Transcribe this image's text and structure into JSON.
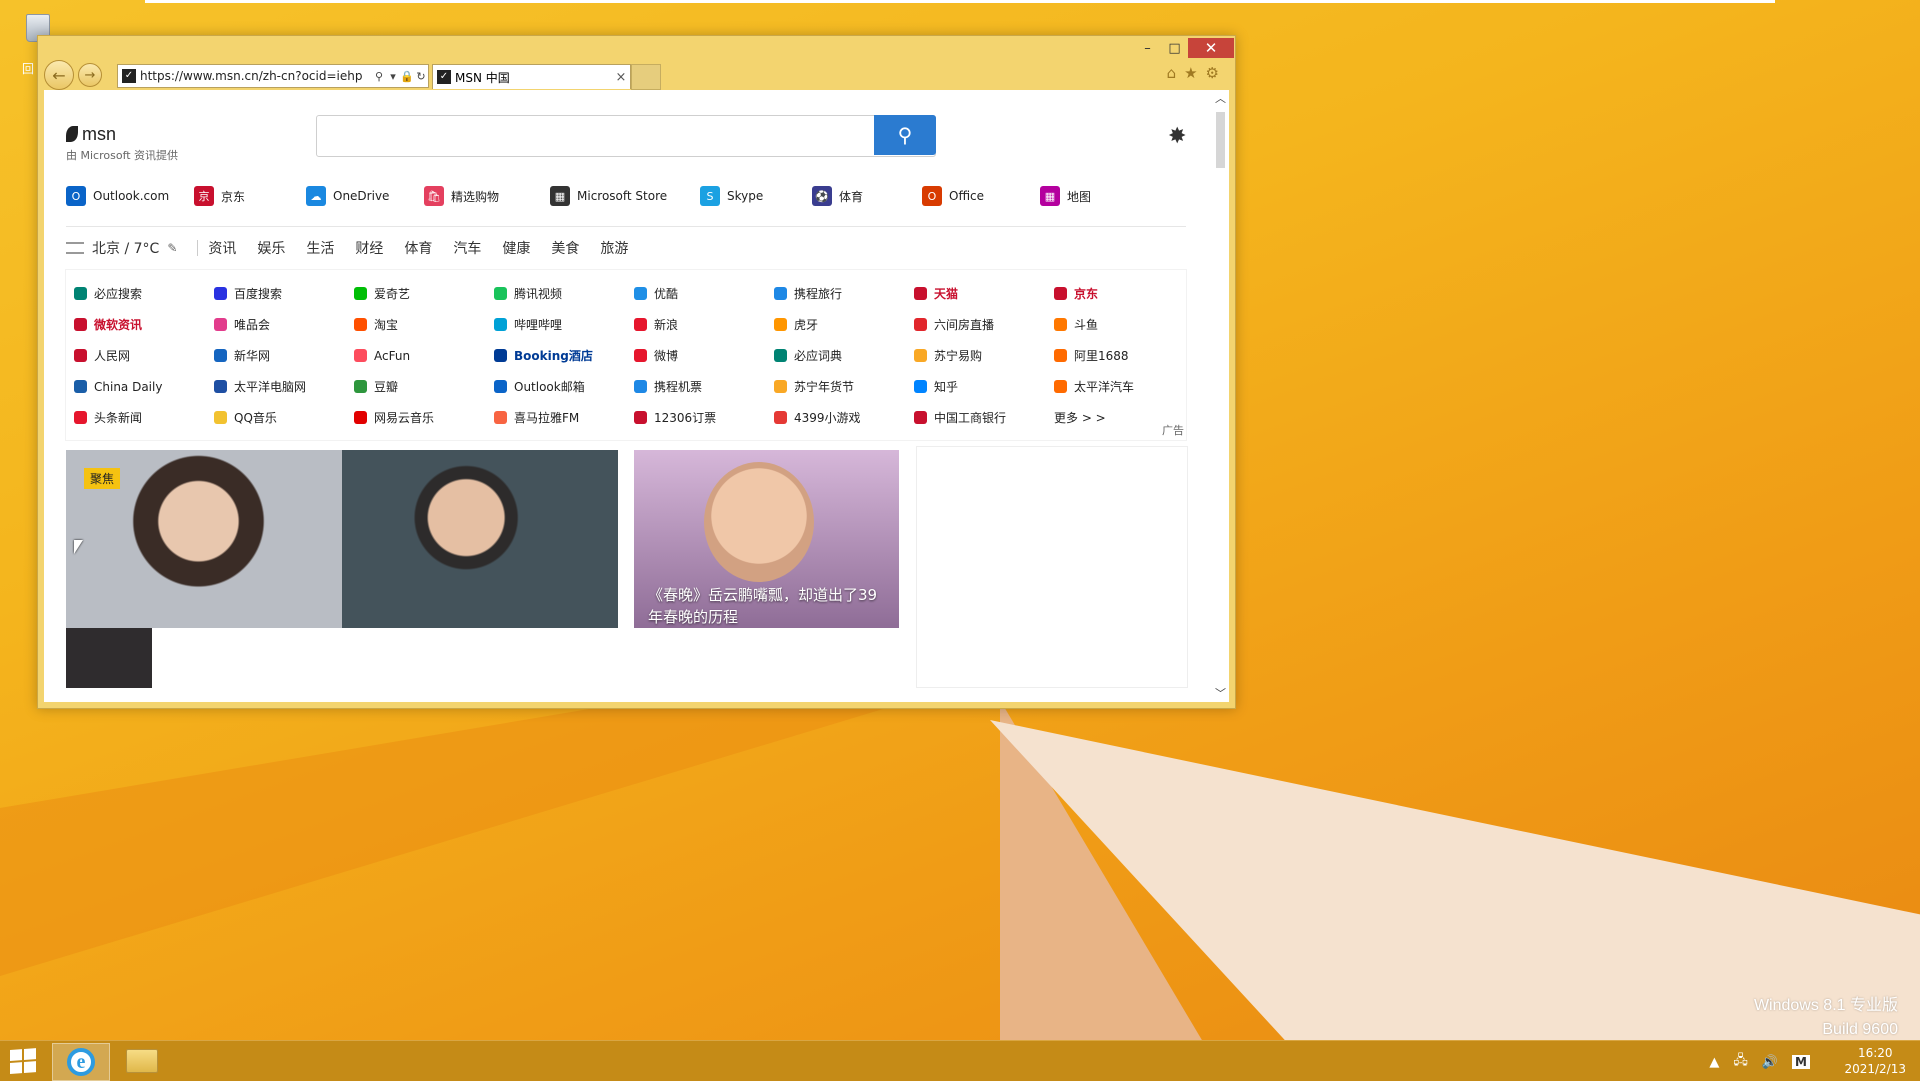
{
  "desktop": {
    "recycle_label": "回",
    "watermark_line1": "Windows 8.1 专业版",
    "watermark_line2": "Build 9600"
  },
  "window": {
    "controls": {
      "minimize": "–",
      "maximize": "□",
      "close": "✕"
    },
    "back_label": "←",
    "forward_label": "→",
    "address_url": "https://www.msn.cn/zh-cn?ocid=iehp",
    "address_icons": [
      "⚲",
      "▾",
      "🔒",
      "↻"
    ],
    "tab_title": "MSN 中国",
    "tab_close": "×",
    "tools": [
      "⌂",
      "★",
      "⚙"
    ]
  },
  "msn": {
    "logo_text": "msn",
    "logo_sub": "由 Microsoft 资讯提供",
    "search_icon": "⚲",
    "settings_icon": "✸",
    "quick_links": [
      {
        "label": "Outlook.com",
        "color": "#0a64c8",
        "glyph": "O"
      },
      {
        "label": "京东",
        "color": "#c8102e",
        "glyph": "京"
      },
      {
        "label": "OneDrive",
        "color": "#1a88e0",
        "glyph": "☁"
      },
      {
        "label": "精选购物",
        "color": "#e4405f",
        "glyph": "🛍"
      },
      {
        "label": "Microsoft Store",
        "color": "#333333",
        "glyph": "▦"
      },
      {
        "label": "Skype",
        "color": "#1ba1e2",
        "glyph": "S"
      },
      {
        "label": "体育",
        "color": "#3a3d8f",
        "glyph": "⚽"
      },
      {
        "label": "Office",
        "color": "#d83b01",
        "glyph": "O"
      },
      {
        "label": "地图",
        "color": "#b4009e",
        "glyph": "▦"
      }
    ],
    "weather": "北京 / 7°C",
    "categories": [
      "资讯",
      "娱乐",
      "生活",
      "财经",
      "体育",
      "汽车",
      "健康",
      "美食",
      "旅游"
    ],
    "links": [
      {
        "label": "必应搜索",
        "color": "#008373"
      },
      {
        "label": "百度搜索",
        "color": "#2932e1"
      },
      {
        "label": "爱奇艺",
        "color": "#00be06"
      },
      {
        "label": "腾讯视频",
        "color": "#19c35b"
      },
      {
        "label": "优酷",
        "color": "#1f8fe6"
      },
      {
        "label": "携程旅行",
        "color": "#1e88e5"
      },
      {
        "label": "天猫",
        "color": "#c8102e",
        "style": "red"
      },
      {
        "label": "京东",
        "color": "#c8102e",
        "style": "red"
      },
      {
        "label": "微软资讯",
        "color": "#c8102e",
        "style": "red"
      },
      {
        "label": "唯品会",
        "color": "#e23c8c"
      },
      {
        "label": "淘宝",
        "color": "#ff5000"
      },
      {
        "label": "哔哩哔哩",
        "color": "#00a1d6"
      },
      {
        "label": "新浪",
        "color": "#e6162d"
      },
      {
        "label": "虎牙",
        "color": "#ff9600"
      },
      {
        "label": "六间房直播",
        "color": "#e1262c"
      },
      {
        "label": "斗鱼",
        "color": "#ff7800"
      },
      {
        "label": "人民网",
        "color": "#c8102e"
      },
      {
        "label": "新华网",
        "color": "#1565c0"
      },
      {
        "label": "AcFun",
        "color": "#fd4c5d"
      },
      {
        "label": "Booking酒店",
        "color": "#003b95",
        "style": "blue"
      },
      {
        "label": "微博",
        "color": "#e6162d"
      },
      {
        "label": "必应词典",
        "color": "#008373"
      },
      {
        "label": "苏宁易购",
        "color": "#f9a825"
      },
      {
        "label": "阿里1688",
        "color": "#ff6a00"
      },
      {
        "label": "China Daily",
        "color": "#1a5ea8"
      },
      {
        "label": "太平洋电脑网",
        "color": "#1e4fa3"
      },
      {
        "label": "豆瓣",
        "color": "#2e963d"
      },
      {
        "label": "Outlook邮箱",
        "color": "#0a64c8"
      },
      {
        "label": "携程机票",
        "color": "#1e88e5"
      },
      {
        "label": "苏宁年货节",
        "color": "#f9a825"
      },
      {
        "label": "知乎",
        "color": "#0084ff"
      },
      {
        "label": "太平洋汽车",
        "color": "#ff6a00"
      },
      {
        "label": "头条新闻",
        "color": "#e6162d"
      },
      {
        "label": "QQ音乐",
        "color": "#f2c230"
      },
      {
        "label": "网易云音乐",
        "color": "#e20000"
      },
      {
        "label": "喜马拉雅FM",
        "color": "#f86442"
      },
      {
        "label": "12306订票",
        "color": "#c8102e"
      },
      {
        "label": "4399小游戏",
        "color": "#e53935"
      },
      {
        "label": "中国工商银行",
        "color": "#c8102e"
      },
      {
        "label": "更多 > >",
        "color": ""
      }
    ],
    "ad_label": "广告",
    "hero_badge": "聚焦",
    "card2_caption": "《春晚》岳云鹏嘴瓢，却道出了39年春晚的历程"
  },
  "taskbar": {
    "tray_icons": [
      "▲",
      "🖧",
      "🔊",
      "M"
    ],
    "time": "16:20",
    "date": "2021/2/13"
  }
}
